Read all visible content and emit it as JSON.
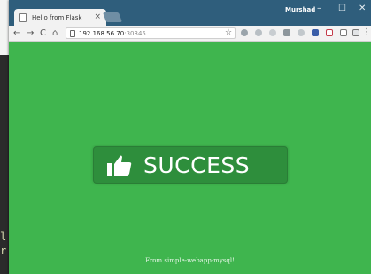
{
  "terminal": {
    "lines": [
      "l",
      "r"
    ]
  },
  "browser": {
    "tab": {
      "title": "Hello from Flask",
      "close": "×"
    },
    "user": "Murshad",
    "window_buttons": {
      "minimize": "–",
      "maximize": "☐",
      "close": "✕"
    },
    "nav": {
      "back": "←",
      "forward": "→",
      "reload": "C",
      "home": "⌂"
    },
    "url": {
      "host": "192.168.56.70",
      "port": ":30345"
    },
    "star": "☆",
    "menu": "⋮"
  },
  "page": {
    "success_label": "SUCCESS",
    "footer": "From simple-webapp-mysql!"
  },
  "colors": {
    "page_bg": "#3fb54e",
    "success_box": "#2e8e3c",
    "titlebar": "#2f5e7c"
  }
}
